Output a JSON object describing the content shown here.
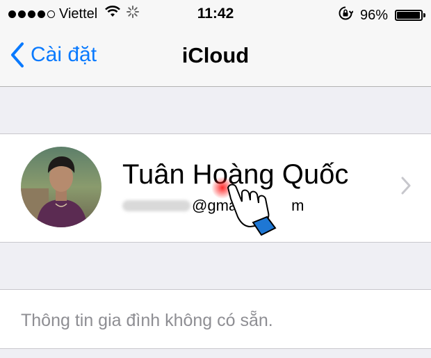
{
  "status_bar": {
    "carrier": "Viettel",
    "time": "11:42",
    "battery_percent": "96%",
    "battery_level": 0.96,
    "signal_bars_filled": 4,
    "signal_bars_total": 5,
    "icons": [
      "wifi-icon",
      "activity-spinner-icon",
      "rotation-lock-icon",
      "battery-icon"
    ]
  },
  "nav": {
    "back_label": "Cài đặt",
    "title": "iCloud"
  },
  "profile": {
    "name": "Tuân Hoàng Quốc",
    "email_visible": "@gma",
    "email_suffix_visible": "m"
  },
  "family": {
    "text": "Thông tin gia đình không có sẵn."
  },
  "colors": {
    "accent": "#0a7afe",
    "background": "#efeff4",
    "secondary_text": "#8e8e93"
  }
}
